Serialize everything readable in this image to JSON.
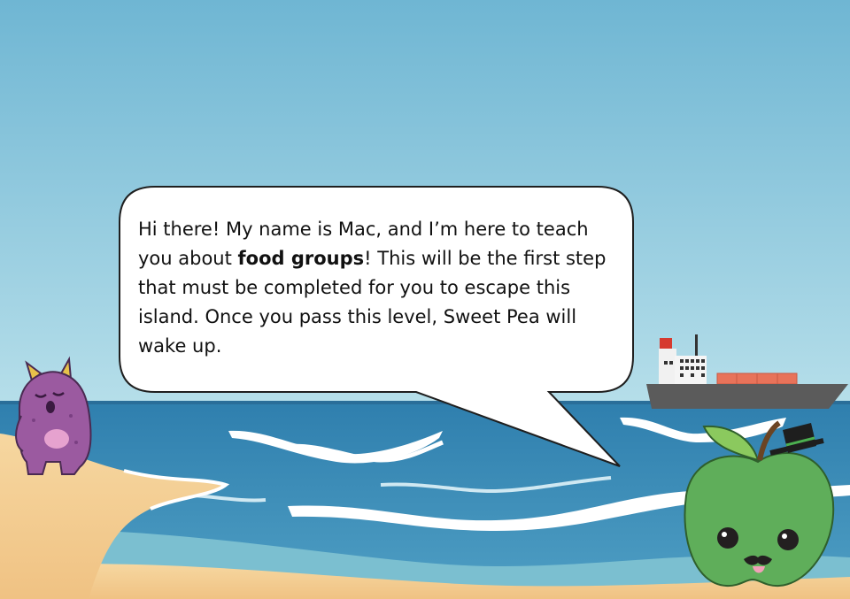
{
  "dialogue": {
    "text_before": "Hi there! My name is Mac, and I’m here to teach you about ",
    "highlight": "food groups",
    "text_after": "! This will be the first step that must be completed for you to escape this island. Once you pass this level, Sweet Pea will wake up."
  },
  "characters": {
    "speaker": {
      "icon": "green-apple-mustache-top-hat-character"
    },
    "sleeper": {
      "icon": "purple-horned-monster-sleeping-character"
    }
  },
  "scenery": {
    "ship_icon": "cargo-ship-icon",
    "colors": {
      "sky_top": "#6fb6d3",
      "sky_bottom": "#a9d8e6",
      "sea": "#3f8fb8",
      "sand": "#f2c98a",
      "apple": "#5fae5a",
      "monster": "#9b5aa0"
    }
  }
}
